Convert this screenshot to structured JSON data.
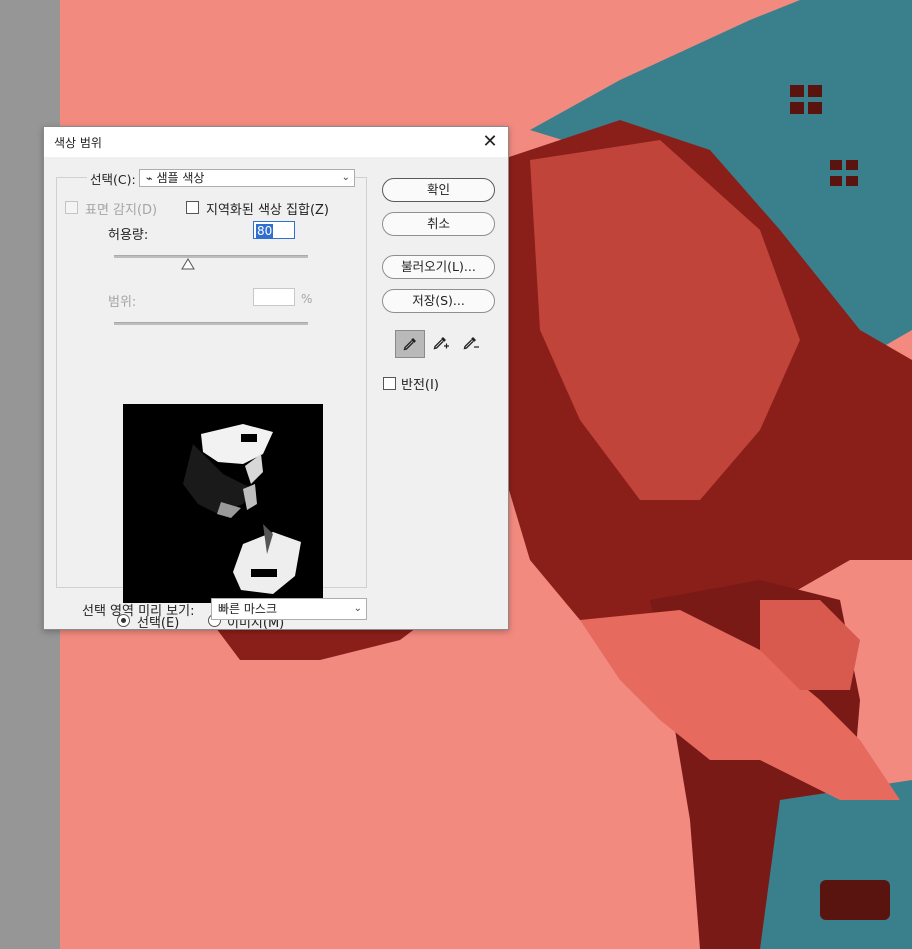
{
  "dialog": {
    "title": "색상 범위",
    "select_label": "선택(C):",
    "select_value": "샘플 색상",
    "detect_faces_label": "표면 감지(D)",
    "localized_label": "지역화된 색상 집합(Z)",
    "fuzziness_label": "허용량:",
    "fuzziness_value": "80",
    "range_label": "범위:",
    "range_unit": "%",
    "radio_selection_label": "선택(E)",
    "radio_image_label": "이미지(M)",
    "preview_label": "선택 영역 미리 보기:",
    "preview_value": "빠른 마스크",
    "fuzziness_fraction": 0.38
  },
  "buttons": {
    "ok": "확인",
    "cancel": "취소",
    "load": "불러오기(L)...",
    "save": "저장(S)..."
  },
  "invert_label": "반전(I)",
  "tools": [
    "eyedropper-icon",
    "eyedropper-plus-icon",
    "eyedropper-minus-icon"
  ],
  "colors": {
    "canvas_overlay": "#f28a80",
    "drill_dark": "#8a1f1a",
    "drill_teal": "#3a7f8c",
    "gutter": "#969696"
  }
}
